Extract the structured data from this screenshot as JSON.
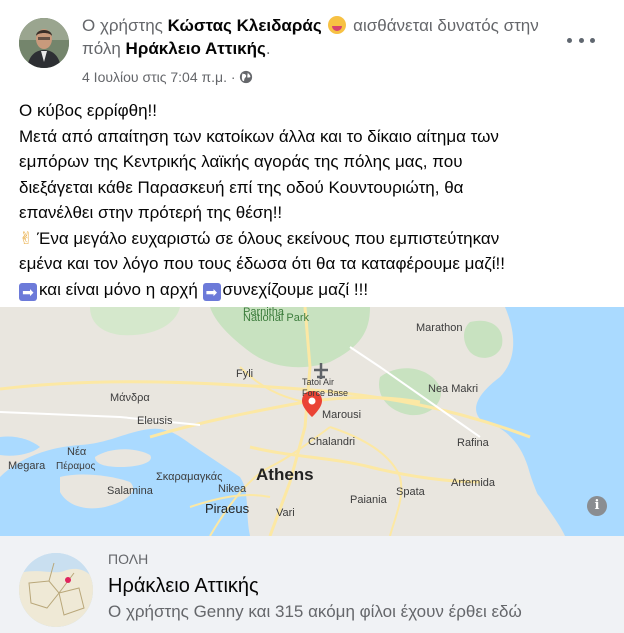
{
  "post": {
    "headline_prefix": "Ο χρήστης ",
    "author": "Κώστας Κλειδαράς",
    "emoji_icon": "hot-face-emoji",
    "headline_middle": " αισθάνεται δυνατός στην πόλη ",
    "location": "Ηράκλειο Αττικής",
    "headline_suffix": ".",
    "date": "4 Ιουλίου στις 7:04 π.μ.",
    "separator": "·",
    "privacy_icon": "public-globe-icon",
    "more_icon": "more-options-icon",
    "lines": [
      "Ο κύβος ερρίφθη!!",
      "Μετά από απαίτηση των κατοίκων άλλα και το δίκαιο αίτημα των",
      "εμπόρων της Κεντρικής λαϊκής αγοράς της πόλης μας, που",
      "διεξάγεται κάθε Παρασκευή επί της οδού Κουντουριώτη, θα",
      "επανέλθει στην πρότερή της θέση!!"
    ],
    "thanks_line_1": "Ένα μεγάλο ευχαριστώ σε όλους εκείνους που εμπιστεύτηκαν",
    "thanks_line_2": "εμένα και τον λόγο που τους έδωσα ότι θα τα καταφέρουμε μαζί!!",
    "last_part_1": "και είναι μόνο η αρχή ",
    "last_part_2": "συνεχίζουμε μαζί  !!!"
  },
  "map": {
    "labels": {
      "park": "Parnitha",
      "park2": "National Park",
      "marathon": "Marathon",
      "fyli": "Fyli",
      "tatoi1": "Tatoi Air",
      "tatoi2": "Force Base",
      "nea_makri": "Nea Makri",
      "mandra": "Μάνδρα",
      "marousi": "Marousi",
      "eleusis": "Eleusis",
      "chalandri": "Chalandri",
      "rafina": "Rafina",
      "nea": "Νέα",
      "megara": "Megara",
      "peramos": "Πέραμος",
      "skaramangas": "Σκαραμαγκάς",
      "athens": "Athens",
      "artemida": "Artemida",
      "salamina": "Salamina",
      "nikea": "Nikea",
      "spata": "Spata",
      "paiania": "Paiania",
      "piraeus": "Piraeus",
      "vari": "Vari"
    },
    "info": "i"
  },
  "place": {
    "kind": "ΠΟΛΗ",
    "name": "Ηράκλειο Αττικής",
    "friends": "Ο χρήστης Genny και 315 ακόμη φίλοι έχουν έρθει εδώ"
  },
  "colors": {
    "land": "#e9e6df",
    "water": "#aadaff",
    "park": "#c8e2c0",
    "road": "#fce8a4",
    "pin": "#ea4335",
    "place_bg": "#f0f2f5"
  }
}
